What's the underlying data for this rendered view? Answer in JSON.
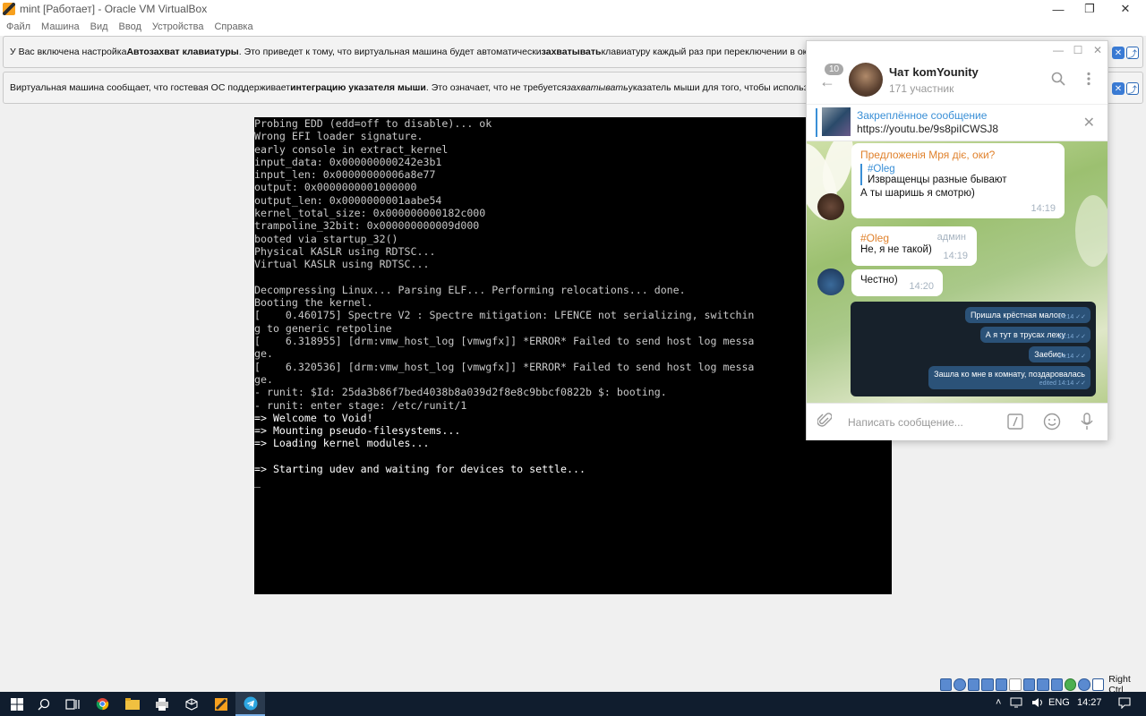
{
  "window": {
    "title": "mint [Работает] - Oracle VM VirtualBox",
    "minimize": "—",
    "maximize": "❐",
    "close": "✕"
  },
  "menu": [
    "Файл",
    "Машина",
    "Вид",
    "Ввод",
    "Устройства",
    "Справка"
  ],
  "notice1": {
    "p1": "У Вас включена настройка ",
    "b1": "Автозахват клавиатуры",
    "p2": ". Это приведет к тому, что виртуальная машина будет автоматически ",
    "b2": "захватывать",
    "p3": " клавиатуру каждый раз при переключении в окно ВМ"
  },
  "notice2": {
    "p1": "Виртуальная машина сообщает, что гостевая ОС поддерживает ",
    "b1": "интеграцию указателя мыши",
    "p2": ". Это означает, что не требуется ",
    "i1": "захватывать",
    "p3": " указатель мыши для того, чтобы использовать её"
  },
  "console": {
    "lines_plain": "Probing EDD (edd=off to disable)... ok\nWrong EFI loader signature.\nearly console in extract_kernel\ninput_data: 0x000000000242e3b1\ninput_len: 0x00000000006a8e77\noutput: 0x0000000001000000\noutput_len: 0x0000000001aabe54\nkernel_total_size: 0x000000000182c000\ntrampoline_32bit: 0x000000000009d000\nbooted via startup_32()\nPhysical KASLR using RDTSC...\nVirtual KASLR using RDTSC...\n\nDecompressing Linux... Parsing ELF... Performing relocations... done.\nBooting the kernel.\n[    0.460175] Spectre V2 : Spectre mitigation: LFENCE not serializing, switchin\ng to generic retpoline\n[    6.318955] [drm:vmw_host_log [vmwgfx]] *ERROR* Failed to send host log messa\nge.\n[    6.320536] [drm:vmw_host_log [vmwgfx]] *ERROR* Failed to send host log messa\nge.\n- runit: $Id: 25da3b86f7bed4038b8a039d2f8e8c9bbcf0822b $: booting.\n- runit: enter stage: /etc/runit/1",
    "lines_bright": "=> Welcome to Void!\n=> Mounting pseudo-filesystems...\n=> Loading kernel modules...\n\n=> Starting udev and waiting for devices to settle...\n_"
  },
  "telegram": {
    "win_min": "—",
    "win_max": "☐",
    "win_close": "✕",
    "back": "←",
    "unread": "10",
    "chat_title": "Чат komYounity",
    "members": "171 участник",
    "pinned_title": "Закреплённое сообщение",
    "pinned_url": "https://youtu.be/9s8piICWSJ8",
    "messages": {
      "m1_author": "Предложенія Мря діє, оки?",
      "m1_reply_author": "#Oleg",
      "m1_reply_text": "Извращенцы разные бывают",
      "m1_text": "А ты шаришь я смотрю)",
      "m1_time": "14:19",
      "m2_author": "#Oleg",
      "m2_role": "админ",
      "m2_text": "Не, я не такой)",
      "m2_time": "14:19",
      "m3_text": "Честно)",
      "m3_time": "14:20"
    },
    "forwarded": [
      {
        "text": "Пришла крёстная малого",
        "time": "14:14 ✓✓"
      },
      {
        "text": "А я тут в трусах лежу",
        "time": "14:14 ✓✓"
      },
      {
        "text": "Заебись",
        "time": "14:14 ✓✓"
      },
      {
        "text": "Зашла ко мне в комнату, поздаровалась",
        "time": "edited 14:14 ✓✓"
      }
    ],
    "input_placeholder": "Написать сообщение..."
  },
  "vbox_status": {
    "host_key": "Right Ctrl"
  },
  "taskbar": {
    "lang": "ENG",
    "time": "14:27"
  }
}
